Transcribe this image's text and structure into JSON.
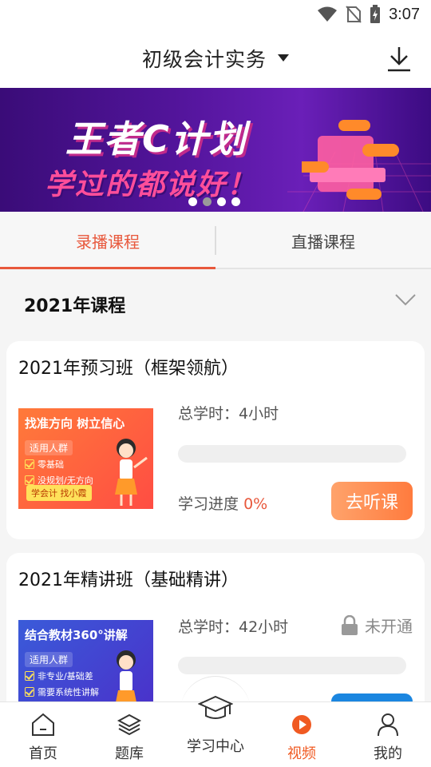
{
  "status_bar": {
    "time": "3:07"
  },
  "header": {
    "title": "初级会计实务"
  },
  "banner": {
    "title": "王者C计划",
    "subtitle": "学过的都说好！",
    "dot_count": 4,
    "active_dot": 1
  },
  "tabs": [
    {
      "label": "录播课程",
      "active": true
    },
    {
      "label": "直播课程",
      "active": false
    }
  ],
  "year_section": {
    "title": "2021年课程"
  },
  "courses": [
    {
      "title": "2021年预习班（框架领航）",
      "thumb_headline": "找准方向 树立信心",
      "thumb_tag": "适用人群",
      "thumb_items": [
        "零基础",
        "没规划/无方向"
      ],
      "thumb_bottom": "学会计 找小霞",
      "hours": "总学时：4小时",
      "progress_label": "学习进度",
      "progress_value": "0%",
      "progress_fraction": 0,
      "button_label": "去听课"
    },
    {
      "title": "2021年精讲班（基础精讲）",
      "thumb_headline": "结合教材360°讲解",
      "thumb_tag": "适用人群",
      "thumb_items": [
        "非专业/基础差",
        "需要系统性讲解"
      ],
      "hours": "总学时：42小时",
      "status": "未开通",
      "progress_fraction": 0
    }
  ],
  "bottom_nav": [
    {
      "label": "首页",
      "icon": "home-icon"
    },
    {
      "label": "题库",
      "icon": "layers-icon"
    },
    {
      "label": "学习中心",
      "icon": "graduation-cap-icon"
    },
    {
      "label": "视频",
      "icon": "video-play-icon",
      "active": true
    },
    {
      "label": "我的",
      "icon": "user-icon"
    }
  ],
  "colors": {
    "accent": "#e8583c",
    "nav_active": "#f05a22"
  }
}
